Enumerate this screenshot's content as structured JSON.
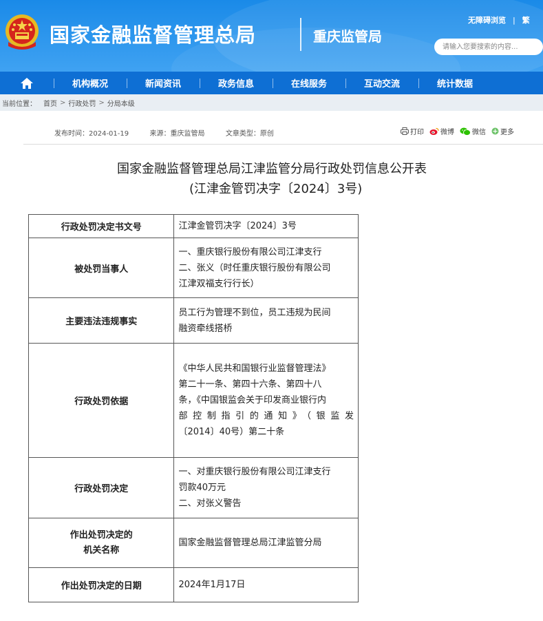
{
  "header": {
    "site_title": "国家金融监督管理总局",
    "site_sub": "重庆监管局",
    "top_links": [
      "无障碍浏览",
      "繁"
    ],
    "search_placeholder": "请输入您要搜索的内容..."
  },
  "nav": {
    "home_icon": "home-icon",
    "items": [
      "机构概况",
      "新闻资讯",
      "政务信息",
      "在线服务",
      "互动交流",
      "统计数据"
    ]
  },
  "breadcrumb": {
    "prefix": "当前位置：",
    "items": [
      "首页",
      "行政处罚",
      "分局本级"
    ],
    "separator": ">"
  },
  "meta": {
    "publish_time": "发布时间：2024-01-19",
    "source": "来源：重庆监管局",
    "doc_type": "文章类型：原创"
  },
  "share": {
    "print": "打印",
    "weibo": "微博",
    "wechat": "微信",
    "more": "更多"
  },
  "document": {
    "title_line1": "国家金融监督管理总局江津监管分局行政处罚信息公开表",
    "title_line2": "(江津金管罚决字〔2024〕3号)"
  },
  "table": {
    "rows": [
      {
        "key": "行政处罚决定书文号",
        "value_lines": [
          "江津金管罚决字〔2024〕3号"
        ]
      },
      {
        "key": "被处罚当事人",
        "value_lines": [
          "一、重庆银行股份有限公司江津支行",
          "二、张义（时任重庆银行股份有限公司",
          "江津双福支行行长）"
        ]
      },
      {
        "key": "主要违法违规事实",
        "value_lines": [
          "员工行为管理不到位，员工违规为民间",
          "融资牵线搭桥"
        ]
      },
      {
        "key": "行政处罚依据",
        "value_lines": [
          "《中华人民共和国银行业监督管理法》",
          "第二十一条、第四十六条、第四十八",
          "条，《中国银监会关于印发商业银行内",
          "部控制指引的通知》（银监发",
          "〔2014〕40号）第二十条"
        ]
      },
      {
        "key": "行政处罚决定",
        "value_lines": [
          "一、对重庆银行股份有限公司江津支行",
          "罚款40万元",
          "二、对张义警告"
        ]
      },
      {
        "key_lines": [
          "作出处罚决定的",
          "机关名称"
        ],
        "value_lines": [
          "国家金融监督管理总局江津监管分局"
        ]
      },
      {
        "key": "作出处罚决定的日期",
        "value_lines": [
          "2024年1月17日"
        ]
      }
    ]
  },
  "colors": {
    "header_blue": "#1a8ae8",
    "nav_blue": "#0e6fd4",
    "breadcrumb_bg": "#e9eef3"
  }
}
